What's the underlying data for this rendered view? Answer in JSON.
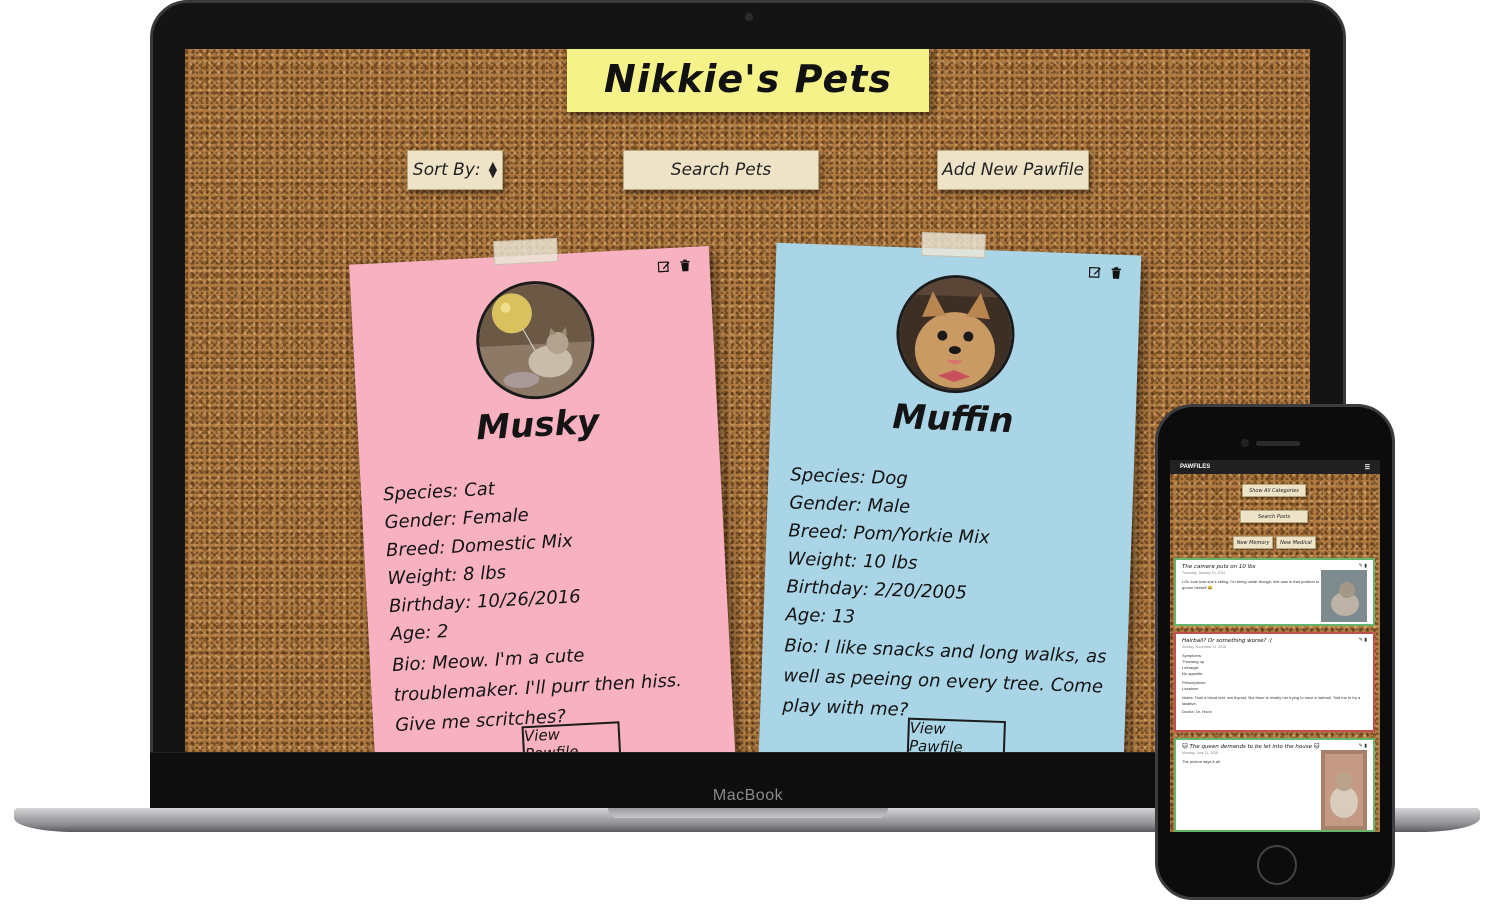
{
  "app": {
    "title": "Nikkie's Pets"
  },
  "toolbar": {
    "sort_label": "Sort By:",
    "search_label": "Search Pets",
    "add_label": "Add New Pawfile"
  },
  "pets": [
    {
      "name": "Musky",
      "species": "Species: Cat",
      "gender": "Gender: Female",
      "breed": "Breed: Domestic Mix",
      "weight": "Weight: 8 lbs",
      "birthday": "Birthday: 10/26/2016",
      "age": "Age: 2",
      "bio": "Bio: Meow. I'm a cute troublemaker. I'll purr then hiss. Give me scritches?",
      "view_label": "View Pawfile",
      "card_color": "#f8b1c0"
    },
    {
      "name": "Muffin",
      "species": "Species: Dog",
      "gender": "Gender: Male",
      "breed": "Breed: Pom/Yorkie Mix",
      "weight": "Weight: 10 lbs",
      "birthday": "Birthday: 2/20/2005",
      "age": "Age: 13",
      "bio": "Bio: I like snacks and long walks, as well as peeing on every tree. Come play with me?",
      "view_label": "View Pawfile",
      "card_color": "#a9d5e6"
    }
  ],
  "laptop": {
    "brand": "MacBook"
  },
  "phone": {
    "nav_title": "PAWFILES",
    "show_all_label": "Show All Categories",
    "search_label": "Search Posts",
    "new_memory_label": "New Memory",
    "new_medical_label": "New Medical",
    "entries": [
      {
        "title": "The camera puts on 10 lbs",
        "date": "Thursday, January 10, 2019",
        "body": "LOL look how she's sitting. I'm being unfair though, she was in that position to groom herself 😂"
      },
      {
        "title": "Hairball? Or something worse? :(",
        "date": "Sunday, November 11, 2018",
        "symptoms_label": "Symptoms:",
        "symptoms": [
          "Throwing up",
          "Lethargic",
          "No appetite"
        ],
        "prescriptions_label": "Prescriptions:",
        "prescriptions": [
          "Laxatone"
        ],
        "notes": "Notes: Took a blood test, low thyroid. But there is mostly her trying to have a hairball. Told me to try a laxative.",
        "doctor": "Doctor: Dr. Hoon"
      },
      {
        "title": "🐱 The queen demands to be let into the house 🐱",
        "date": "Monday, June 11, 2018",
        "body": "The picture says it all."
      }
    ]
  }
}
